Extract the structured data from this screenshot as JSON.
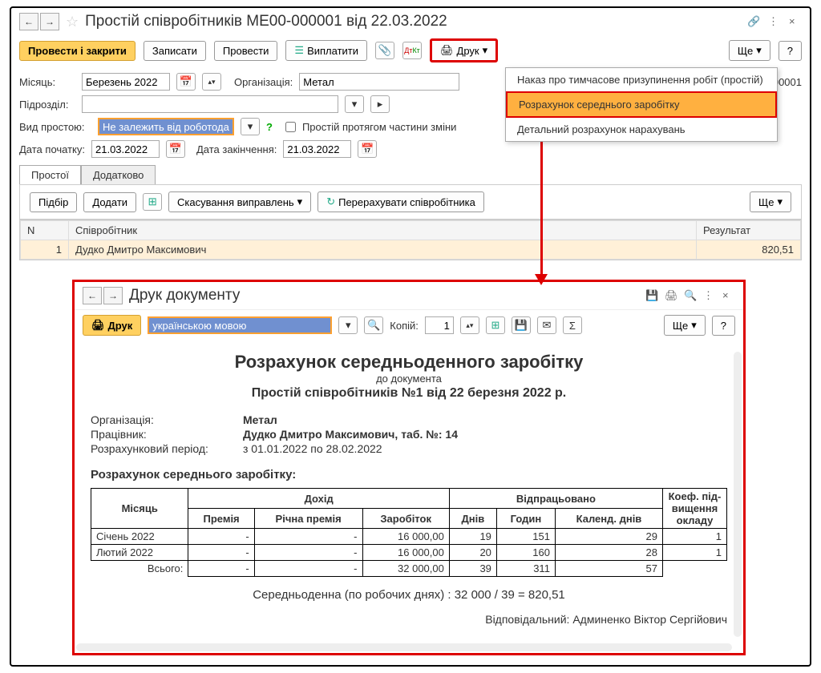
{
  "header": {
    "title": "Простій співробітників МЕ00-000001 від 22.03.2022"
  },
  "toolbar": {
    "execute_close": "Провести і закрити",
    "save": "Записати",
    "execute": "Провести",
    "pay": "Виплатити",
    "print": "Друк",
    "more": "Ще",
    "help": "?"
  },
  "print_menu": {
    "item1": "Наказ про тимчасове призупинення робіт (простій)",
    "item2": "Розрахунок середнього заробітку",
    "item3": "Детальний розрахунок нарахувань"
  },
  "form": {
    "month_label": "Місяць:",
    "month_value": "Березень 2022",
    "org_label": "Організація:",
    "org_value": "Метал",
    "doc_number": "00-000001",
    "division_label": "Підрозділ:",
    "type_label": "Вид простою:",
    "type_value": "Не залежить від роботодав",
    "partial_shift": "Простій протягом частини зміни",
    "start_label": "Дата початку:",
    "start_value": "21.03.2022",
    "end_label": "Дата закінчення:",
    "end_value": "21.03.2022"
  },
  "tabs": {
    "tab1": "Простої",
    "tab2": "Додатково"
  },
  "sub_toolbar": {
    "select": "Підбір",
    "add": "Додати",
    "cancel_fix": "Скасування виправлень",
    "recalc": "Перерахувати співробітника",
    "more": "Ще"
  },
  "table": {
    "col_n": "N",
    "col_employee": "Співробітник",
    "col_result": "Результат",
    "row1_n": "1",
    "row1_employee": "Дудко Дмитро Максимович",
    "row1_result": "820,51"
  },
  "inner": {
    "title": "Друк документу",
    "print_btn": "Друк",
    "lang": "українською мовою",
    "copies_label": "Копій:",
    "copies_value": "1",
    "more": "Ще",
    "help": "?"
  },
  "doc": {
    "title": "Розрахунок середньоденного заробітку",
    "subtitle": "до документа",
    "subtitle2": "Простій співробітників №1 від 22 березня 2022 р.",
    "org_label": "Організація:",
    "org_value": "Метал",
    "employee_label": "Працівник:",
    "employee_value": "Дудко Дмитро Максимович, таб. №: 14",
    "period_label": "Розрахунковий період:",
    "period_value": "з 01.01.2022 по 28.02.2022",
    "section": "Розрахунок середнього заробітку:",
    "summary": "Середньоденна (по робочих днях) : 32 000 / 39 =   820,51",
    "responsible": "Відповідальний: Админенко Віктор Сергійович"
  },
  "calc_headers": {
    "month": "Місяць",
    "income": "Дохід",
    "worked": "Відпрацьовано",
    "coef": "Коеф. під-вищення окладу",
    "bonus": "Премія",
    "year_bonus": "Річна премія",
    "earnings": "Заробіток",
    "days": "Днів",
    "hours": "Годин",
    "cal_days": "Календ. днів",
    "total": "Всього:"
  },
  "chart_data": {
    "type": "table",
    "title": "Розрахунок середнього заробітку",
    "columns": [
      "Місяць",
      "Премія",
      "Річна премія",
      "Заробіток",
      "Днів",
      "Годин",
      "Календ. днів",
      "Коеф. підвищення окладу"
    ],
    "rows": [
      {
        "month": "Січень 2022",
        "bonus": "-",
        "year_bonus": "-",
        "earnings": "16 000,00",
        "days": 19,
        "hours": 151,
        "cal_days": 29,
        "coef": 1
      },
      {
        "month": "Лютий 2022",
        "bonus": "-",
        "year_bonus": "-",
        "earnings": "16 000,00",
        "days": 20,
        "hours": 160,
        "cal_days": 28,
        "coef": 1
      }
    ],
    "totals": {
      "bonus": "-",
      "year_bonus": "-",
      "earnings": "32 000,00",
      "days": 39,
      "hours": 311,
      "cal_days": 57
    }
  }
}
